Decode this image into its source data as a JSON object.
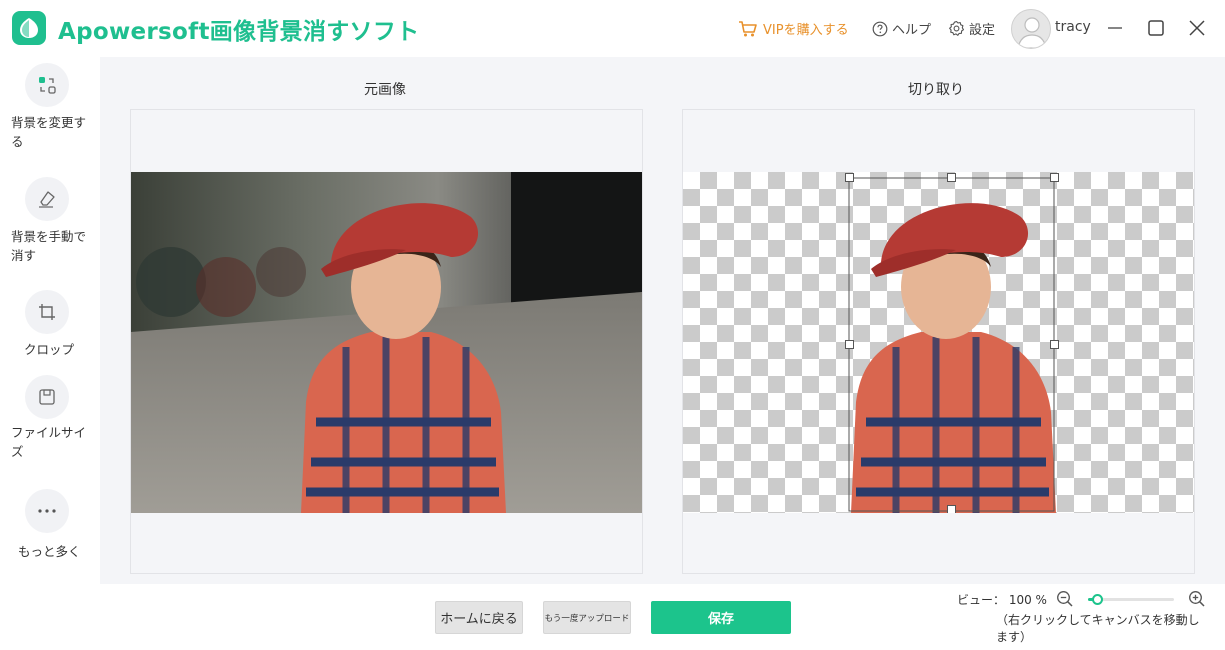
{
  "app": {
    "title": "Apowersoft画像背景消すソフト",
    "vip_label": "VIPを購入する",
    "help_label": "ヘルプ",
    "settings_label": "設定",
    "username": "tracy",
    "brand_color": "#1fbf8f",
    "vip_color": "#e8912b"
  },
  "sidebar": {
    "items": [
      {
        "label": "背景を変更する",
        "icon": "change-background-icon"
      },
      {
        "label": "背景を手動で消す",
        "icon": "manual-erase-icon"
      },
      {
        "label": "クロップ",
        "icon": "crop-icon"
      },
      {
        "label": "ファイルサイズ",
        "icon": "file-size-icon"
      },
      {
        "label": "もっと多く",
        "icon": "more-dots-icon"
      }
    ]
  },
  "panels": {
    "original_title": "元画像",
    "cutout_title": "切り取り"
  },
  "bottom": {
    "home_label": "ホームに戻る",
    "reupload_label": "もう一度アップロード",
    "save_label": "保存",
    "view_label": "ビュー： 100 %",
    "zoom_value": 0.1,
    "hint": "（右クリックしてキャンバスを移動します）"
  }
}
